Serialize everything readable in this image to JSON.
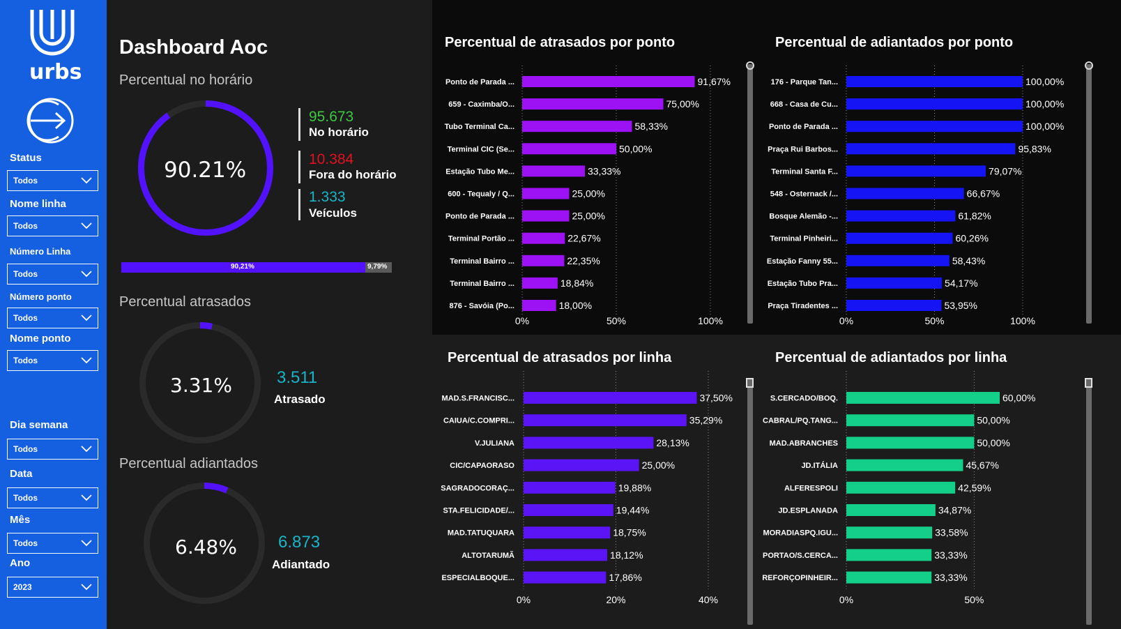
{
  "sidebar": {
    "logo_text": "urbs",
    "filters": [
      {
        "label": "Status",
        "value": "Todos"
      },
      {
        "label": "Nome linha",
        "value": "Todos"
      },
      {
        "label": "Número Linha",
        "value": "Todos"
      },
      {
        "label": "Número ponto",
        "value": "Todos"
      },
      {
        "label": "Nome ponto",
        "value": "Todos"
      },
      {
        "label": "Dia semana",
        "value": "Todos"
      },
      {
        "label": "Data",
        "value": "Todos"
      },
      {
        "label": "Mês",
        "value": "Todos"
      },
      {
        "label": "Ano",
        "value": "2023"
      }
    ]
  },
  "dashboard": {
    "title": "Dashboard Aoc",
    "on_time": {
      "section": "Percentual no horário",
      "percent": 90.21,
      "percent_label": "90.21%",
      "kpis": [
        {
          "value": "95.673",
          "label": "No horário",
          "color": "#3cc840"
        },
        {
          "value": "10.384",
          "label": "Fora do horário",
          "color": "#e0121f"
        },
        {
          "value": "1.333",
          "label": "Veículos",
          "color": "#18b4c8"
        }
      ],
      "stack": {
        "a_label": "90,21%",
        "a_value": 90.21,
        "b_label": "9,79%",
        "b_value": 9.79
      }
    },
    "late": {
      "section": "Percentual atrasados",
      "percent": 3.31,
      "percent_label": "3.31%",
      "count": "3.511",
      "label": "Atrasado"
    },
    "early": {
      "section": "Percentual adiantados",
      "percent": 6.48,
      "percent_label": "6.48%",
      "count": "6.873",
      "label": "Adiantado"
    }
  },
  "colors": {
    "gauge": "#5312ff",
    "gauge_track": "#2a2a2a",
    "bar_purple": "#9d12f5",
    "bar_blue": "#1414f5",
    "bar_violet": "#5a14f5",
    "bar_green": "#14cf8a"
  },
  "chart_data": [
    {
      "id": "atrasados-ponto",
      "type": "bar",
      "title": "Percentual de atrasados por ponto",
      "categories": [
        "Ponto de Parada ...",
        "659 - Caximba/O...",
        "Tubo Terminal Ca...",
        "Terminal CIC (Se...",
        "Estação Tubo Me...",
        "600 - Tequaly / Q...",
        "Ponto de Parada ...",
        "Terminal Portão ...",
        "Terminal Bairro ...",
        "Terminal Bairro ...",
        "876 - Savóia (Po..."
      ],
      "values": [
        91.67,
        75.0,
        58.33,
        50.0,
        33.33,
        25.0,
        25.0,
        22.67,
        22.35,
        18.84,
        18.0
      ],
      "labels": [
        "91,67%",
        "75,00%",
        "58,33%",
        "50,00%",
        "33,33%",
        "25,00%",
        "25,00%",
        "22,67%",
        "22,35%",
        "18,84%",
        "18,00%"
      ],
      "xlim": [
        0,
        100
      ],
      "xticks": [
        "0%",
        "50%",
        "100%"
      ],
      "color": "#9d12f5"
    },
    {
      "id": "adiantados-ponto",
      "type": "bar",
      "title": "Percentual de adiantados por ponto",
      "categories": [
        "176 - Parque Tan...",
        "668 - Casa de Cu...",
        "Ponto de Parada ...",
        "Praça Rui Barbos...",
        "Terminal Santa F...",
        "548 - Osternack /...",
        "Bosque Alemão -...",
        "Terminal Pinheiri...",
        "Estação Fanny 55...",
        "Estação Tubo Pra...",
        "Praça Tiradentes ..."
      ],
      "values": [
        100.0,
        100.0,
        100.0,
        95.83,
        79.07,
        66.67,
        61.82,
        60.26,
        58.43,
        54.17,
        53.95
      ],
      "labels": [
        "100,00%",
        "100,00%",
        "100,00%",
        "95,83%",
        "79,07%",
        "66,67%",
        "61,82%",
        "60,26%",
        "58,43%",
        "54,17%",
        "53,95%"
      ],
      "xlim": [
        0,
        100
      ],
      "xticks": [
        "0%",
        "50%",
        "100%"
      ],
      "color": "#1414f5"
    },
    {
      "id": "atrasados-linha",
      "type": "bar",
      "title": "Percentual de atrasados por linha",
      "categories": [
        "MAD.S.FRANCISC...",
        "CAIUA/C.COMPRI...",
        "V.JULIANA",
        "CIC/CAPAORASO",
        "SAGRADOCORAÇ...",
        "STA.FELICIDADE/...",
        "MAD.TATUQUARA",
        "ALTOTARUMÃ",
        "ESPECIALBOQUE..."
      ],
      "values": [
        37.5,
        35.29,
        28.13,
        25.0,
        19.88,
        19.44,
        18.75,
        18.12,
        17.86
      ],
      "labels": [
        "37,50%",
        "35,29%",
        "28,13%",
        "25,00%",
        "19,88%",
        "19,44%",
        "18,75%",
        "18,12%",
        "17,86%"
      ],
      "xlim": [
        0,
        40
      ],
      "xticks": [
        "0%",
        "20%",
        "40%"
      ],
      "color": "#5a14f5"
    },
    {
      "id": "adiantados-linha",
      "type": "bar",
      "title": "Percentual de adiantados por linha",
      "categories": [
        "S.CERCADO/BOQ.",
        "CABRAL/PQ.TANG...",
        "MAD.ABRANCHES",
        "JD.ITÁLIA",
        "ALFERESPOLI",
        "JD.ESPLANADA",
        "MORADIASPQ.IGU...",
        "PORTAO/S.CERCA...",
        "REFORÇOPINHEIR..."
      ],
      "values": [
        60.0,
        50.0,
        50.0,
        45.67,
        42.59,
        34.87,
        33.58,
        33.33,
        33.33
      ],
      "labels": [
        "60,00%",
        "50,00%",
        "50,00%",
        "45,67%",
        "42,59%",
        "34,87%",
        "33,58%",
        "33,33%",
        "33,33%"
      ],
      "xlim": [
        0,
        60
      ],
      "xticks": [
        "0%",
        "50%"
      ],
      "xtick_values": [
        0,
        50
      ],
      "color": "#14cf8a"
    }
  ]
}
